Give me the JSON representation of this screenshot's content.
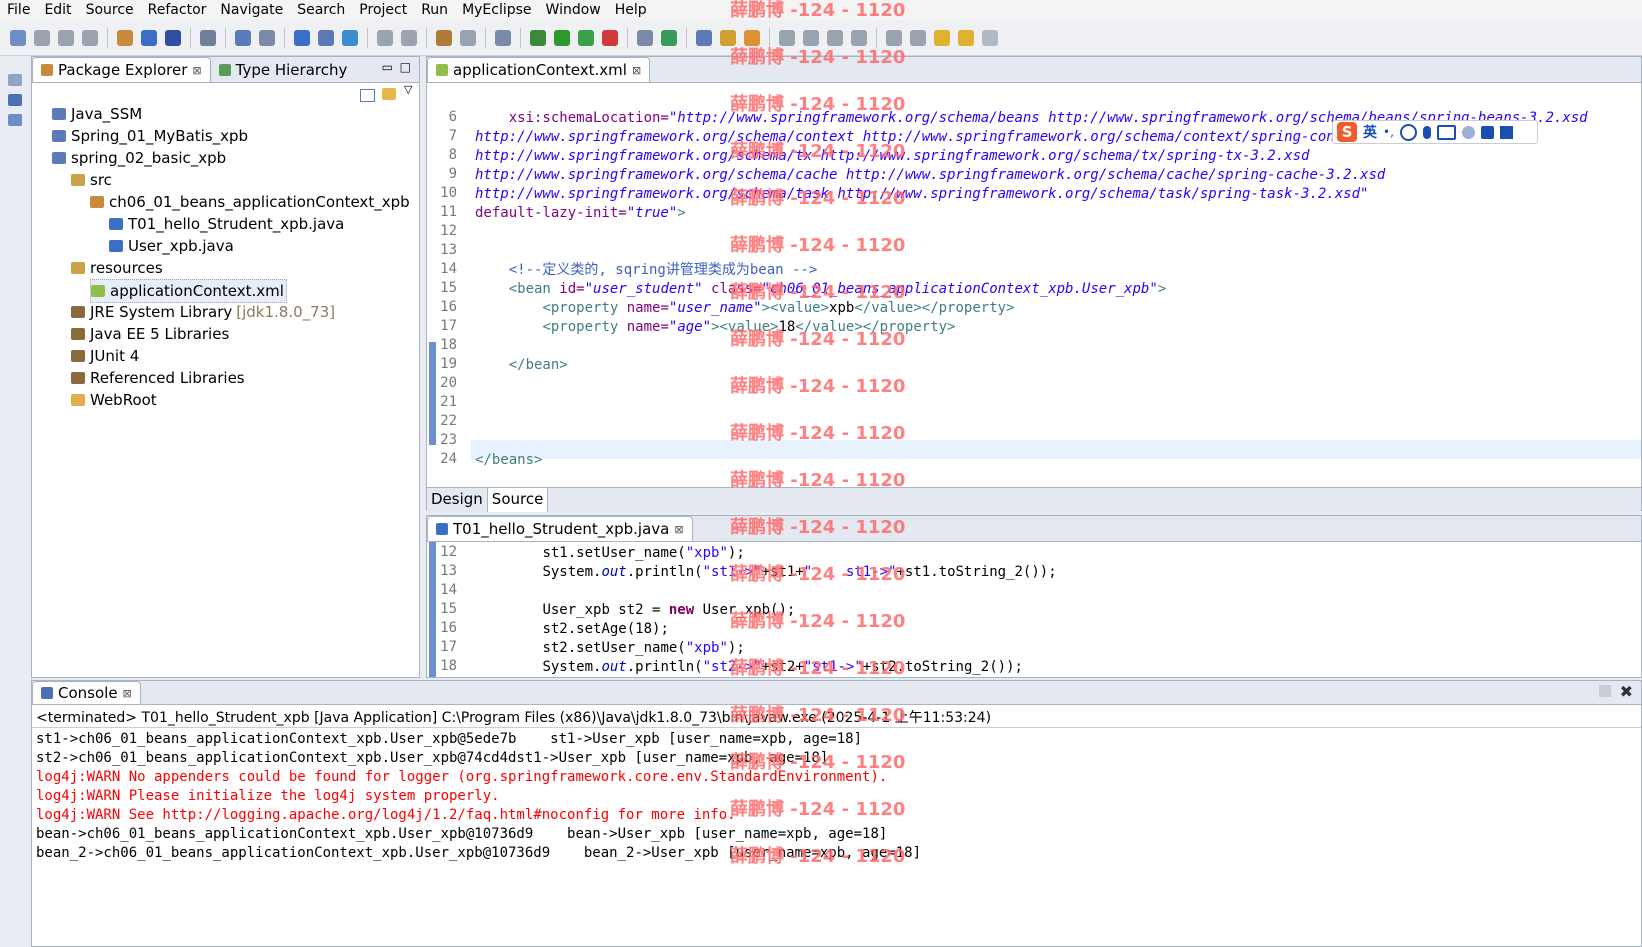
{
  "menu": [
    "File",
    "Edit",
    "Source",
    "Refactor",
    "Navigate",
    "Search",
    "Project",
    "Run",
    "MyEclipse",
    "Window",
    "Help"
  ],
  "explorer": {
    "tabs": [
      {
        "label": "Package Explorer"
      },
      {
        "label": "Type Hierarchy"
      }
    ],
    "tree": [
      {
        "label": "Java_SSM",
        "indent": 0,
        "icon": "project-icon"
      },
      {
        "label": "Spring_01_MyBatis_xpb",
        "indent": 0,
        "icon": "project-icon"
      },
      {
        "label": "spring_02_basic_xpb",
        "indent": 0,
        "icon": "project-icon"
      },
      {
        "label": "src",
        "indent": 1,
        "icon": "source-folder-icon"
      },
      {
        "label": "ch06_01_beans_applicationContext_xpb",
        "indent": 2,
        "icon": "package-icon"
      },
      {
        "label": "T01_hello_Strudent_xpb.java",
        "indent": 3,
        "icon": "java-file-icon"
      },
      {
        "label": "User_xpb.java",
        "indent": 3,
        "icon": "java-file-icon"
      },
      {
        "label": "resources",
        "indent": 1,
        "icon": "source-folder-icon"
      },
      {
        "label": "applicationContext.xml",
        "indent": 2,
        "icon": "xml-file-icon",
        "selected": true
      },
      {
        "label": "JRE System Library",
        "suffix": "[jdk1.8.0_73]",
        "indent": 1,
        "icon": "library-icon"
      },
      {
        "label": "Java EE 5 Libraries",
        "indent": 1,
        "icon": "library-icon"
      },
      {
        "label": "JUnit 4",
        "indent": 1,
        "icon": "library-icon"
      },
      {
        "label": "Referenced Libraries",
        "indent": 1,
        "icon": "library-icon"
      },
      {
        "label": "WebRoot",
        "indent": 1,
        "icon": "folder-icon"
      }
    ]
  },
  "xml_editor": {
    "tab_label": "applicationContext.xml",
    "line_numbers": [
      "6",
      "7",
      "8",
      "9",
      "10",
      "11",
      "12",
      "13",
      "14",
      "15",
      "16",
      "17",
      "18",
      "19",
      "20",
      "21",
      "22",
      "23",
      "24"
    ],
    "bottom_tabs": [
      "Design",
      "Source"
    ],
    "code": {
      "l6_a": "xsi:schemaLocation=",
      "l6_b": "\"http://www.springframework.org/schema/beans http://www.springframework.org/schema/beans/spring-beans-3.2.xsd",
      "l7": "http://www.springframework.org/schema/context http://www.springframework.org/schema/context/spring-context-3.2.xsd",
      "l8": "http://www.springframework.org/schema/tx http://www.springframework.org/schema/tx/spring-tx-3.2.xsd",
      "l9": "http://www.springframework.org/schema/cache http://www.springframework.org/schema/cache/spring-cache-3.2.xsd",
      "l10": "http://www.springframework.org/schema/task http://www.springframework.org/schema/task/spring-task-3.2.xsd\"",
      "l11_a": "default-lazy-init=",
      "l11_b": "\"true\"",
      "l11_c": ">",
      "l14": "<!--定义类的, sqring讲管理类成为bean -->",
      "l15_a": "<bean ",
      "l15_b": "id=",
      "l15_c": "\"user_student\"",
      "l15_d": " class=",
      "l15_e": "\"ch06_01_beans_applicationContext_xpb.User_xpb\"",
      "l15_f": ">",
      "l16_a": "<property ",
      "l16_b": "name=",
      "l16_c": "\"user_name\"",
      "l16_d": "><value>",
      "l16_e": "xpb",
      "l16_f": "</value></property>",
      "l17_a": "<property ",
      "l17_b": "name=",
      "l17_c": "\"age\"",
      "l17_d": "><value>",
      "l17_e": "18",
      "l17_f": "</value></property>",
      "l19": "</bean>",
      "l24": "</beans>"
    }
  },
  "ime_bar": {
    "lang": "英",
    "symbols": "•,"
  },
  "java_editor": {
    "tab_label": "T01_hello_Strudent_xpb.java",
    "line_numbers": [
      "12",
      "13",
      "14",
      "15",
      "16",
      "17",
      "18"
    ],
    "code": {
      "l12_a": "st1.setUser_name(",
      "l12_b": "\"xpb\"",
      "l12_c": ");",
      "l13_a": "System.",
      "l13_b": "out",
      "l13_c": ".println(",
      "l13_d": "\"st1->\"",
      "l13_e": "+st1+",
      "l13_f": "\"    st1->\"",
      "l13_g": "+st1.toString_2());",
      "l15_a": "User_xpb st2 = ",
      "l15_b": "new",
      "l15_c": " User_xpb();",
      "l16": "st2.setAge(18);",
      "l17_a": "st2.setUser_name(",
      "l17_b": "\"xpb\"",
      "l17_c": ");",
      "l18_a": "System.",
      "l18_b": "out",
      "l18_c": ".println(",
      "l18_d": "\"st2->\"",
      "l18_e": "+st2+",
      "l18_f": "\"st1->\"",
      "l18_g": "+st2.toString_2());"
    }
  },
  "console": {
    "tab_label": "Console",
    "header": "<terminated> T01_hello_Strudent_xpb [Java Application] C:\\Program Files (x86)\\Java\\jdk1.8.0_73\\bin\\javaw.exe (2025-4-1 上午11:53:24)",
    "lines": [
      {
        "text": "st1->ch06_01_beans_applicationContext_xpb.User_xpb@5ede7b    st1->User_xpb [user_name=xpb, age=18]",
        "warn": false
      },
      {
        "text": "st2->ch06_01_beans_applicationContext_xpb.User_xpb@74cd4dst1->User_xpb [user_name=xpb, age=18]",
        "warn": false
      },
      {
        "text": "log4j:WARN No appenders could be found for logger (org.springframework.core.env.StandardEnvironment).",
        "warn": true
      },
      {
        "text": "log4j:WARN Please initialize the log4j system properly.",
        "warn": true
      },
      {
        "text": "log4j:WARN See http://logging.apache.org/log4j/1.2/faq.html#noconfig for more info.",
        "warn": true
      },
      {
        "text": "bean->ch06_01_beans_applicationContext_xpb.User_xpb@10736d9    bean->User_xpb [user_name=xpb, age=18]",
        "warn": false
      },
      {
        "text": "bean_2->ch06_01_beans_applicationContext_xpb.User_xpb@10736d9    bean_2->User_xpb [user_name=xpb, age=18]",
        "warn": false
      }
    ]
  },
  "watermark": "薛鹏博 -124 - 1120",
  "colors": {
    "selection": "#e8f0ff",
    "current_line": "#e8f2fe",
    "warn": "#ff0000",
    "watermark": "#ff6a6a"
  }
}
